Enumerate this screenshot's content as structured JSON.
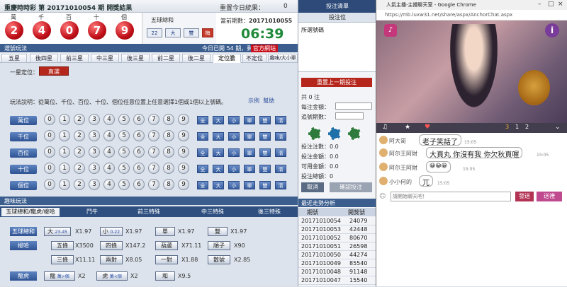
{
  "header": {
    "title_left": "重慶時時彩 第 20171010054 期 開獎結果",
    "title_mid": "重置今日統果：",
    "title_mid_val": "0",
    "side_title": "投注清單"
  },
  "positions": [
    "萬",
    "千",
    "百",
    "十",
    "個"
  ],
  "result_balls": [
    "2",
    "4",
    "0",
    "7",
    "9"
  ],
  "five_ball": {
    "title": "五球總和",
    "buttons": [
      "22",
      "大",
      "雙",
      "梅"
    ]
  },
  "draw": {
    "label": "當前期數：",
    "issue": "20171010055",
    "clock": "06:39"
  },
  "tabs_bar": {
    "left": "選號玩法",
    "today": "今日已開 54 期，剩餘 66 期",
    "official": "官方網站"
  },
  "subtabs": [
    "五星",
    "後四星",
    "前三星",
    "中三星",
    "後三星",
    "前二星",
    "後二星",
    "定位膽",
    "不定位",
    "趣味/大小單雙"
  ],
  "definition": {
    "label": "一星定位：",
    "button": "直選"
  },
  "description": "玩法說明：從萬位、千位、百位、十位、個位任意位置上任意選擇1個或1個以上號碼。",
  "desc_links": [
    "示例",
    "幫助"
  ],
  "rows": [
    "萬位",
    "千位",
    "百位",
    "十位",
    "個位"
  ],
  "digits": [
    "0",
    "1",
    "2",
    "3",
    "4",
    "5",
    "6",
    "7",
    "8",
    "9"
  ],
  "row_buttons": [
    "全",
    "大",
    "小",
    "單",
    "雙",
    "清"
  ],
  "side": {
    "sub": "投注位",
    "list_label": "所選號碼",
    "reset": "重置上一期投注",
    "count": "共 0 注",
    "multiple": "每注金額：",
    "periods": "追號期數：",
    "bet": "投注注數：0.0",
    "total": "投注金額：0.0",
    "avail": "可用金額：0.0",
    "bal": "投注總額：0",
    "btn_cancel": "取消",
    "btn_ok": "確認投注"
  },
  "bottom": {
    "bar": "趣味玩法",
    "tabs": [
      "五球總和/龍虎/梭哈",
      "鬥牛",
      "前三特殊",
      "中三特殊",
      "後三特殊"
    ],
    "rows": [
      {
        "label": "五球總和",
        "items": [
          [
            "大",
            "23-45",
            "X1.97"
          ],
          [
            "小",
            "0-22",
            "X1.97"
          ],
          [
            "單",
            "",
            "X1.97"
          ],
          [
            "雙",
            "",
            "X1.97"
          ]
        ]
      },
      {
        "label": "梭哈",
        "items": [
          [
            "五條",
            "",
            "X3500"
          ],
          [
            "四條",
            "",
            "X147.2"
          ],
          [
            "葫蘆",
            "",
            "X71.11"
          ],
          [
            "順子",
            "",
            "X90"
          ]
        ]
      },
      {
        "label": "",
        "items": [
          [
            "三條",
            "",
            "X11.11"
          ],
          [
            "兩對",
            "",
            "X8.05"
          ],
          [
            "一對",
            "",
            "X1.88"
          ],
          [
            "散號",
            "",
            "X2.85"
          ]
        ]
      },
      {
        "label": "龍虎",
        "items": [
          [
            "龍",
            "萬>個",
            "X2"
          ],
          [
            "虎",
            "萬<個",
            "X2"
          ],
          [
            "和",
            "",
            "X9.5"
          ]
        ]
      }
    ]
  },
  "trend": {
    "title": "最近走勢分析",
    "cols": [
      "期號",
      "開獎號"
    ],
    "rows": [
      [
        "20171010054",
        "24079"
      ],
      [
        "20171010053",
        "42448"
      ],
      [
        "20171010052",
        "80670"
      ],
      [
        "20171010051",
        "26598"
      ],
      [
        "20171010050",
        "44274"
      ],
      [
        "20171010049",
        "85540"
      ],
      [
        "20171010048",
        "91148"
      ],
      [
        "20171010047",
        "15540"
      ]
    ]
  },
  "chrome": {
    "title": "人氣主播-主播聊天室 - Google Chrome",
    "url": "https://mb.luxw31.net/share/aspx/AnchorChat.aspx",
    "video_counts": [
      "3",
      "1",
      "2"
    ],
    "messages": [
      {
        "name": "阿大哥",
        "text": "老子笑話了",
        "time": "15:05"
      },
      {
        "name": "阿尔王阿財",
        "text": "大頁丸 你沒有我 你欠秋頁喔",
        "time": "15:05"
      },
      {
        "name": "阿尔王阿財",
        "text": "😀😀😀",
        "time": "15:05"
      },
      {
        "name": "小小何的",
        "text": "兀",
        "time": "15:05"
      }
    ],
    "input_placeholder": "請開始聊天吧！",
    "btn_send": "發送",
    "btn_gift": "送禮"
  },
  "colors": {
    "accent_red": "#c7131e",
    "nav_blue": "#3b5e8f"
  }
}
